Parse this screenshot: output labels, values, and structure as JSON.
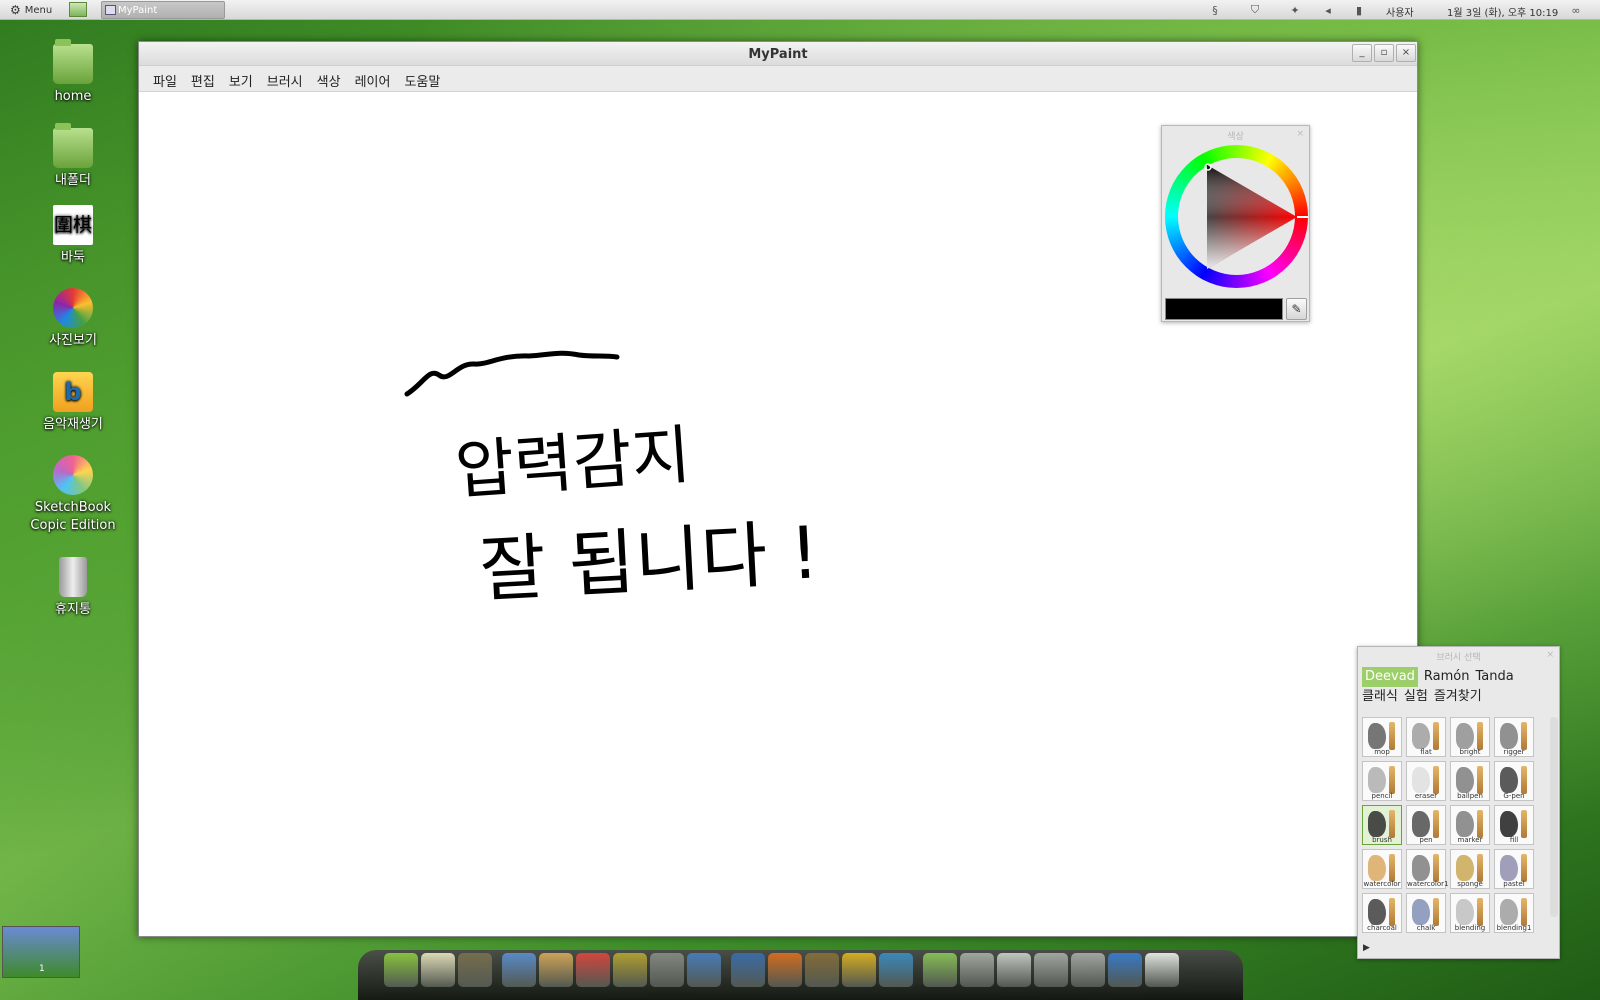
{
  "top_panel": {
    "menu_label": "Menu",
    "task_label": "MyPaint",
    "tray_user": "사용자",
    "clock": "1월 3일 (화), 오후 10:19"
  },
  "desktop_icons": [
    {
      "label": "home",
      "icon": "home-folder-icon"
    },
    {
      "label": "내폴더",
      "icon": "folder-icon"
    },
    {
      "label": "바둑",
      "icon": "baduk-icon",
      "glyph": "圍棋"
    },
    {
      "label": "사진보기",
      "icon": "picasa-icon"
    },
    {
      "label": "음악재생기",
      "icon": "music-player-icon"
    },
    {
      "label": "SketchBook",
      "label2": "Copic Edition",
      "icon": "sketchbook-icon"
    },
    {
      "label": "휴지통",
      "icon": "trash-icon"
    }
  ],
  "window": {
    "title": "MyPaint",
    "menu": [
      "파일",
      "편집",
      "보기",
      "브러시",
      "색상",
      "레이어",
      "도움말"
    ]
  },
  "color_panel": {
    "title": "색상",
    "current_color": "#000000"
  },
  "brush_panel": {
    "title": "브러시 선택",
    "groups": [
      "Deevad",
      "Ramón",
      "Tanda",
      "클래식",
      "실험",
      "즐겨찾기"
    ],
    "active_group": "Deevad",
    "brushes": [
      {
        "name": "mop",
        "color": "#555555"
      },
      {
        "name": "flat",
        "color": "#999999"
      },
      {
        "name": "bright",
        "color": "#888888"
      },
      {
        "name": "rigger",
        "color": "#777777"
      },
      {
        "name": "pencil",
        "color": "#aaaaaa"
      },
      {
        "name": "eraser",
        "color": "#dddddd"
      },
      {
        "name": "ballpen",
        "color": "#777777"
      },
      {
        "name": "G-pen",
        "color": "#333333"
      },
      {
        "name": "brush",
        "color": "#222222"
      },
      {
        "name": "pen",
        "color": "#444444"
      },
      {
        "name": "marker",
        "color": "#777777"
      },
      {
        "name": "fill",
        "color": "#111111"
      },
      {
        "name": "watercolor",
        "color": "#d9a45a"
      },
      {
        "name": "watercolor1",
        "color": "#777777"
      },
      {
        "name": "sponge",
        "color": "#c8a44a"
      },
      {
        "name": "pastel",
        "color": "#8888aa"
      },
      {
        "name": "charcoal",
        "color": "#333333"
      },
      {
        "name": "chalk",
        "color": "#7a8ab0"
      },
      {
        "name": "blending",
        "color": "#bbbbbb"
      },
      {
        "name": "blending1",
        "color": "#999999"
      }
    ]
  },
  "canvas": {
    "handwriting_line1": "압력감지",
    "handwriting_line2": "잘 됩니다 !"
  },
  "workspace": {
    "number": "1"
  },
  "dock": [
    {
      "icon": "mint-menu-icon",
      "color": "#8cc63f"
    },
    {
      "icon": "text-editor-icon",
      "color": "#e8e0c0"
    },
    {
      "icon": "gimp-icon",
      "color": "#7a6a50"
    },
    {
      "icon": "mypaint-icon",
      "color": "#5a8ad4"
    },
    {
      "icon": "image-viewer-icon",
      "color": "#d9a45a"
    },
    {
      "icon": "picasa-icon",
      "color": "#e04040"
    },
    {
      "icon": "photo-wallpaper-icon",
      "color": "#b8a030"
    },
    {
      "icon": "calculator-icon",
      "color": "#888888"
    },
    {
      "icon": "writer-icon",
      "color": "#4a7ac4"
    },
    {
      "icon": "thunderbird-icon",
      "color": "#3a6ab0"
    },
    {
      "icon": "firefox-icon",
      "color": "#e06a20"
    },
    {
      "icon": "mortar-icon",
      "color": "#8a6a3a"
    },
    {
      "icon": "archive-icon",
      "color": "#e0b020"
    },
    {
      "icon": "aperture-icon",
      "color": "#3a8ac8"
    },
    {
      "icon": "home-folder-icon",
      "color": "#8cc25a"
    },
    {
      "icon": "documents-folder-icon",
      "color": "#aaaaaa"
    },
    {
      "icon": "search-icon",
      "color": "#cccccc"
    },
    {
      "icon": "downloads-folder-icon",
      "color": "#aaaaaa"
    },
    {
      "icon": "pictures-folder-icon",
      "color": "#aaaaaa"
    },
    {
      "icon": "accessibility-icon",
      "color": "#3a7ad4"
    },
    {
      "icon": "device-icon",
      "color": "#eeeeee"
    }
  ]
}
